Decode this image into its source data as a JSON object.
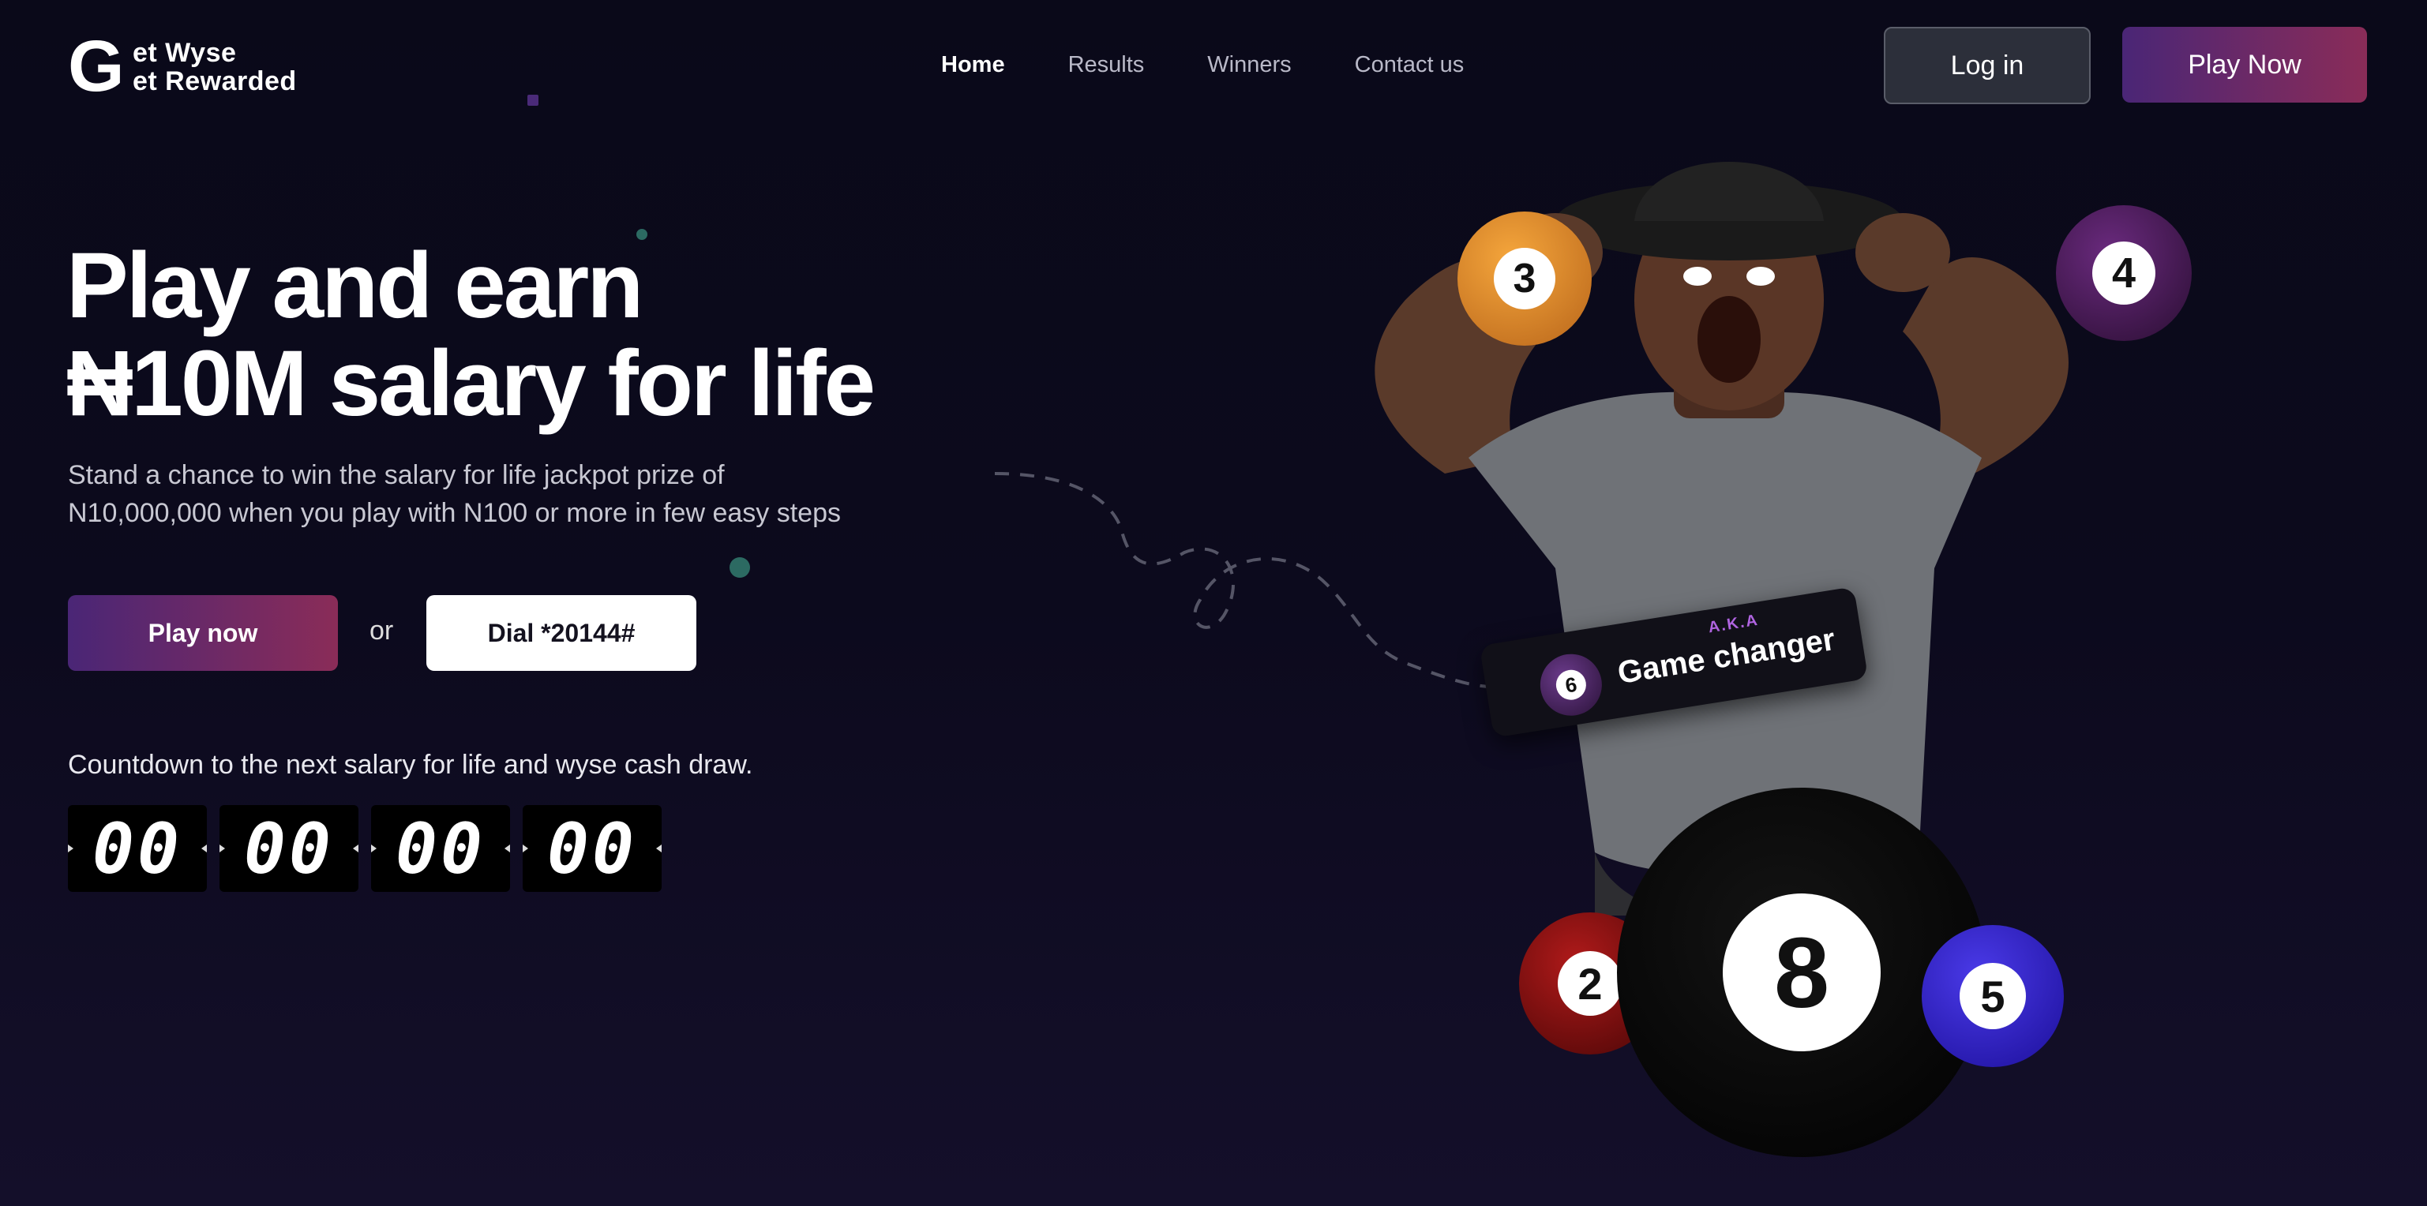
{
  "logo": {
    "big_letter": "G",
    "line1": "et Wyse",
    "line2": "et Rewarded"
  },
  "nav": {
    "items": [
      "Home",
      "Results",
      "Winners",
      "Contact us"
    ],
    "active": "Home"
  },
  "header": {
    "login_label": "Log in",
    "play_label": "Play Now"
  },
  "hero": {
    "headline_line1": "Play and earn",
    "headline_line2": "₦10M salary for life",
    "subtext_line1": "Stand a chance to win the salary for life jackpot prize of",
    "subtext_line2": "N10,000,000 when you play with N100 or more in few easy steps",
    "play_button": "Play now",
    "or_text": "or",
    "dial_button": "Dial *20144#"
  },
  "countdown": {
    "label": "Countdown to the next salary for life and wyse cash draw.",
    "values": [
      "00",
      "00",
      "00",
      "00"
    ]
  },
  "artwork": {
    "balls": [
      "3",
      "4",
      "6",
      "2",
      "8",
      "5"
    ],
    "tag_small": "A.K.A",
    "tag_title": "Game changer",
    "colors": {
      "orange": "#e8902a",
      "purple": "#4a1f5e",
      "red": "#8a1414",
      "blue": "#3322d8",
      "black": "#050505"
    }
  }
}
